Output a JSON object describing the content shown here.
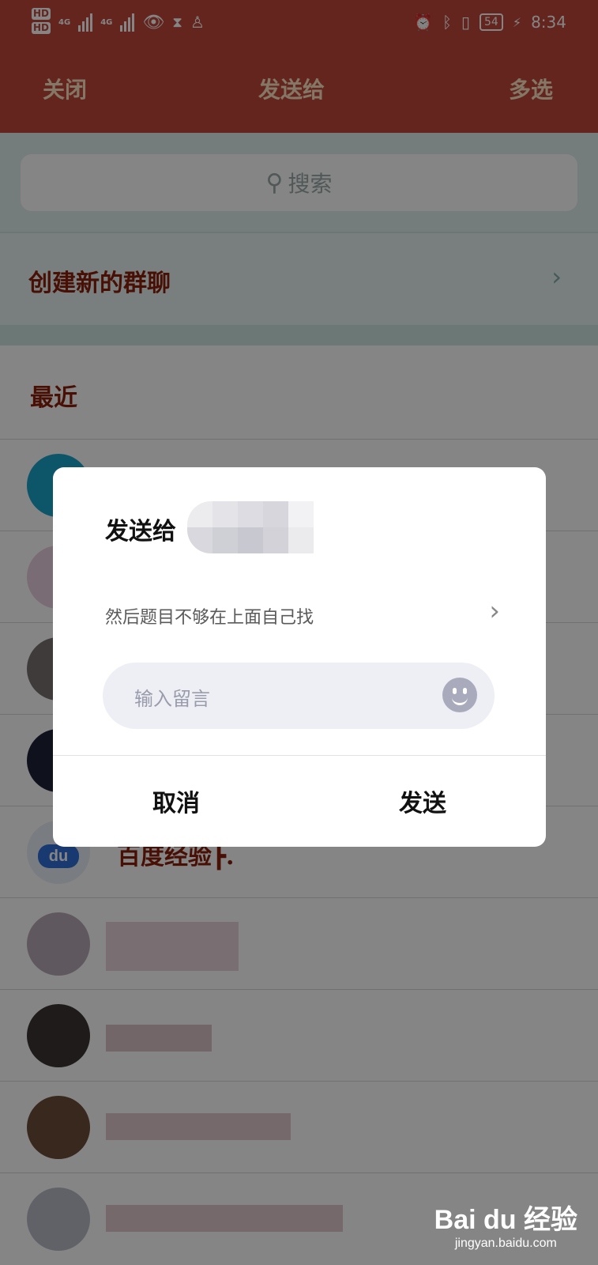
{
  "status_bar": {
    "network_hd1": "HD",
    "network_hd2": "HD",
    "signal1_label": "4G",
    "signal2_label": "4G",
    "battery": "54",
    "time": "8:34"
  },
  "header": {
    "close_label": "关闭",
    "title": "发送给",
    "multi_select_label": "多选"
  },
  "search": {
    "placeholder": "搜索"
  },
  "create_group": {
    "label": "创建新的群聊"
  },
  "recent": {
    "heading": "最近",
    "visible_item_name": "百度经验┣."
  },
  "dialog": {
    "title": "发送给",
    "message": "然后题目不够在上面自己找",
    "input_placeholder": "输入留言",
    "cancel_label": "取消",
    "send_label": "发送"
  },
  "watermark": {
    "main": "Bai du 经验",
    "sub": "jingyan.baidu.com"
  },
  "colors": {
    "header_red": "#c0473a",
    "accent_text": "#8b1d0a",
    "search_bg": "#dff0ee"
  }
}
